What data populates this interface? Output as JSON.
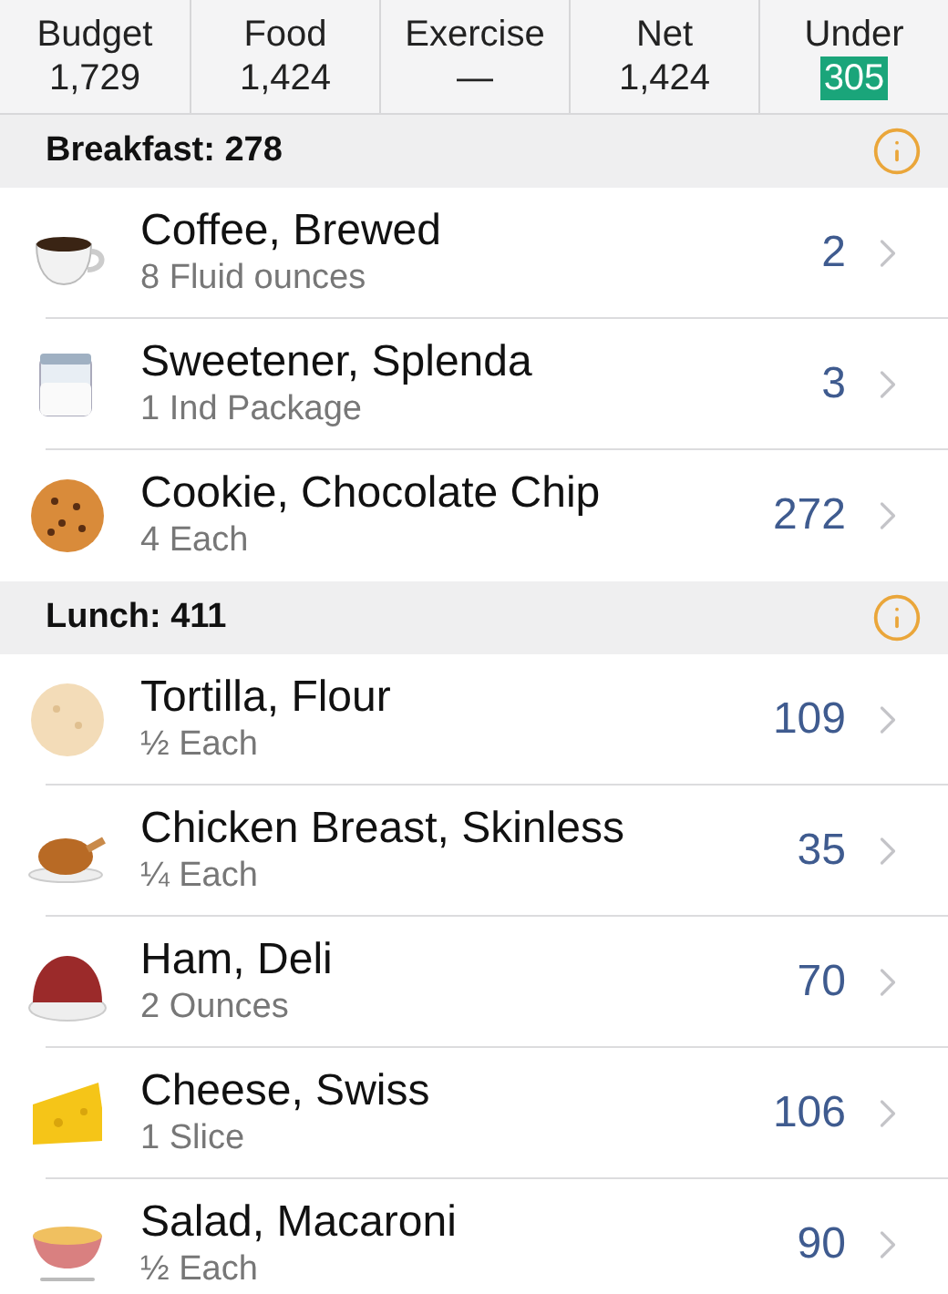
{
  "summary": [
    {
      "label": "Budget",
      "value": "1,729",
      "highlighted": false
    },
    {
      "label": "Food",
      "value": "1,424",
      "highlighted": false
    },
    {
      "label": "Exercise",
      "value": "—",
      "highlighted": false
    },
    {
      "label": "Net",
      "value": "1,424",
      "highlighted": false
    },
    {
      "label": "Under",
      "value": "305",
      "highlighted": true
    }
  ],
  "meals": [
    {
      "title": "Breakfast: 278",
      "items": [
        {
          "kind": "cup",
          "name": "Coffee, Brewed",
          "amount": "8 Fluid ounces",
          "calories": "2"
        },
        {
          "kind": "jar",
          "name": "Sweetener, Splenda",
          "amount": "1 Ind Package",
          "calories": "3"
        },
        {
          "kind": "cookie",
          "name": "Cookie, Chocolate Chip",
          "amount": "4 Each",
          "calories": "272"
        }
      ]
    },
    {
      "title": "Lunch: 411",
      "items": [
        {
          "kind": "tortilla",
          "name": "Tortilla, Flour",
          "amount": "½ Each",
          "calories": "109"
        },
        {
          "kind": "chicken",
          "name": "Chicken Breast, Skinless",
          "amount": "¼ Each",
          "calories": "35"
        },
        {
          "kind": "ham",
          "name": "Ham, Deli",
          "amount": "2 Ounces",
          "calories": "70"
        },
        {
          "kind": "cheese",
          "name": "Cheese, Swiss",
          "amount": "1 Slice",
          "calories": "106"
        },
        {
          "kind": "bowl",
          "name": "Salad, Macaroni",
          "amount": "½ Each",
          "calories": "90"
        }
      ]
    }
  ]
}
